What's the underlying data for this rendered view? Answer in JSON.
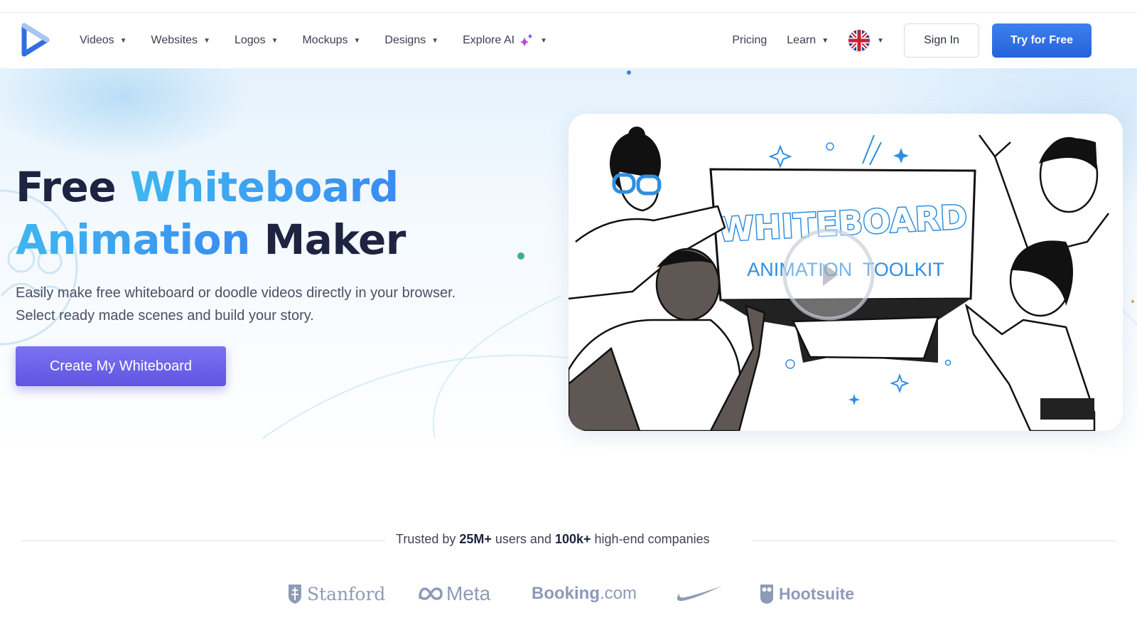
{
  "nav": {
    "items": [
      {
        "label": "Videos",
        "has_dropdown": true
      },
      {
        "label": "Websites",
        "has_dropdown": true
      },
      {
        "label": "Logos",
        "has_dropdown": true
      },
      {
        "label": "Mockups",
        "has_dropdown": true
      },
      {
        "label": "Designs",
        "has_dropdown": true
      },
      {
        "label": "Explore AI",
        "has_dropdown": true,
        "icon": "sparkle-icon"
      }
    ],
    "right": {
      "pricing": "Pricing",
      "learn": "Learn",
      "language_icon": "uk-flag-icon",
      "sign_in": "Sign In",
      "try_free": "Try for Free"
    },
    "caret_glyph": "▼"
  },
  "hero": {
    "title_line1_dark": "Free",
    "title_line1_accent": "Whiteboard",
    "title_line2_accent": "Animation",
    "title_line2_dark": "Maker",
    "subtitle_line1": "Easily make free whiteboard or doodle videos directly in your browser.",
    "subtitle_line2": "Select ready made scenes and build your story.",
    "cta": "Create My Whiteboard",
    "media": {
      "board_title": "WHITEBOARD",
      "board_subtitle": "ANIMATION  TOOLKIT",
      "play_icon": "play-icon"
    }
  },
  "trusted": {
    "prefix": "Trusted by ",
    "users": "25M+",
    "middle": " users and ",
    "companies": "100k+",
    "suffix": " high-end companies"
  },
  "logos": {
    "stanford": "Stanford",
    "meta": "Meta",
    "booking_main": "Booking",
    "booking_suffix": ".com",
    "nike": "nike-swoosh",
    "hootsuite": "Hootsuite"
  },
  "colors": {
    "brand_blue": "#2f6fe0",
    "accent_gradient_start": "#3fb6ef",
    "accent_gradient_end": "#3a8cf0",
    "cta_purple": "#6b62ea",
    "heading_dark": "#1d2340",
    "logo_gray": "#8e9ab8"
  }
}
